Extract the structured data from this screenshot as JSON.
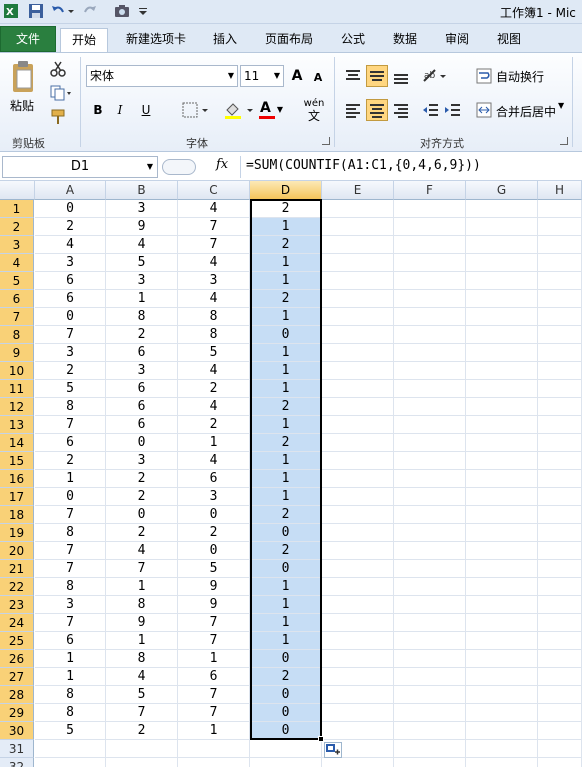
{
  "window": {
    "title": "工作簿1 - Mic"
  },
  "tabs": [
    {
      "label": "文件"
    },
    {
      "label": "开始"
    },
    {
      "label": "新建选项卡"
    },
    {
      "label": "插入"
    },
    {
      "label": "页面布局"
    },
    {
      "label": "公式"
    },
    {
      "label": "数据"
    },
    {
      "label": "审阅"
    },
    {
      "label": "视图"
    }
  ],
  "ribbon": {
    "clipboard": {
      "paste_label": "粘贴",
      "group_label": "剪贴板"
    },
    "font": {
      "font_name": "宋体",
      "font_size": "11",
      "bold": "B",
      "italic": "I",
      "underline": "U",
      "grow": "A",
      "shrink": "A",
      "font_color_letter": "A",
      "phonetic": "wén",
      "group_label": "字体"
    },
    "alignment": {
      "wrap_text": "自动换行",
      "merge_center": "合并后居中",
      "group_label": "对齐方式"
    }
  },
  "formula_bar": {
    "name_box": "D1",
    "fx_label": "fx",
    "formula": "=SUM(COUNTIF(A1:C1,{0,4,6,9}))"
  },
  "columns": [
    "A",
    "B",
    "C",
    "D",
    "E",
    "F",
    "G",
    "H"
  ],
  "rows": [
    [
      "0",
      "3",
      "4",
      "2"
    ],
    [
      "2",
      "9",
      "7",
      "1"
    ],
    [
      "4",
      "4",
      "7",
      "2"
    ],
    [
      "3",
      "5",
      "4",
      "1"
    ],
    [
      "6",
      "3",
      "3",
      "1"
    ],
    [
      "6",
      "1",
      "4",
      "2"
    ],
    [
      "0",
      "8",
      "8",
      "1"
    ],
    [
      "7",
      "2",
      "8",
      "0"
    ],
    [
      "3",
      "6",
      "5",
      "1"
    ],
    [
      "2",
      "3",
      "4",
      "1"
    ],
    [
      "5",
      "6",
      "2",
      "1"
    ],
    [
      "8",
      "6",
      "4",
      "2"
    ],
    [
      "7",
      "6",
      "2",
      "1"
    ],
    [
      "6",
      "0",
      "1",
      "2"
    ],
    [
      "2",
      "3",
      "4",
      "1"
    ],
    [
      "1",
      "2",
      "6",
      "1"
    ],
    [
      "0",
      "2",
      "3",
      "1"
    ],
    [
      "7",
      "0",
      "0",
      "2"
    ],
    [
      "8",
      "2",
      "2",
      "0"
    ],
    [
      "7",
      "4",
      "0",
      "2"
    ],
    [
      "7",
      "7",
      "5",
      "0"
    ],
    [
      "8",
      "1",
      "9",
      "1"
    ],
    [
      "3",
      "8",
      "9",
      "1"
    ],
    [
      "7",
      "9",
      "7",
      "1"
    ],
    [
      "6",
      "1",
      "7",
      "1"
    ],
    [
      "1",
      "8",
      "1",
      "0"
    ],
    [
      "1",
      "4",
      "6",
      "2"
    ],
    [
      "8",
      "5",
      "7",
      "0"
    ],
    [
      "8",
      "7",
      "7",
      "0"
    ],
    [
      "5",
      "2",
      "1",
      "0"
    ]
  ],
  "extra_row_numbers": [
    "31",
    "32"
  ],
  "colors": {
    "file_tab": "#2a7f3f",
    "selection": "#c6ddf5",
    "active_header": "#f9d177"
  }
}
